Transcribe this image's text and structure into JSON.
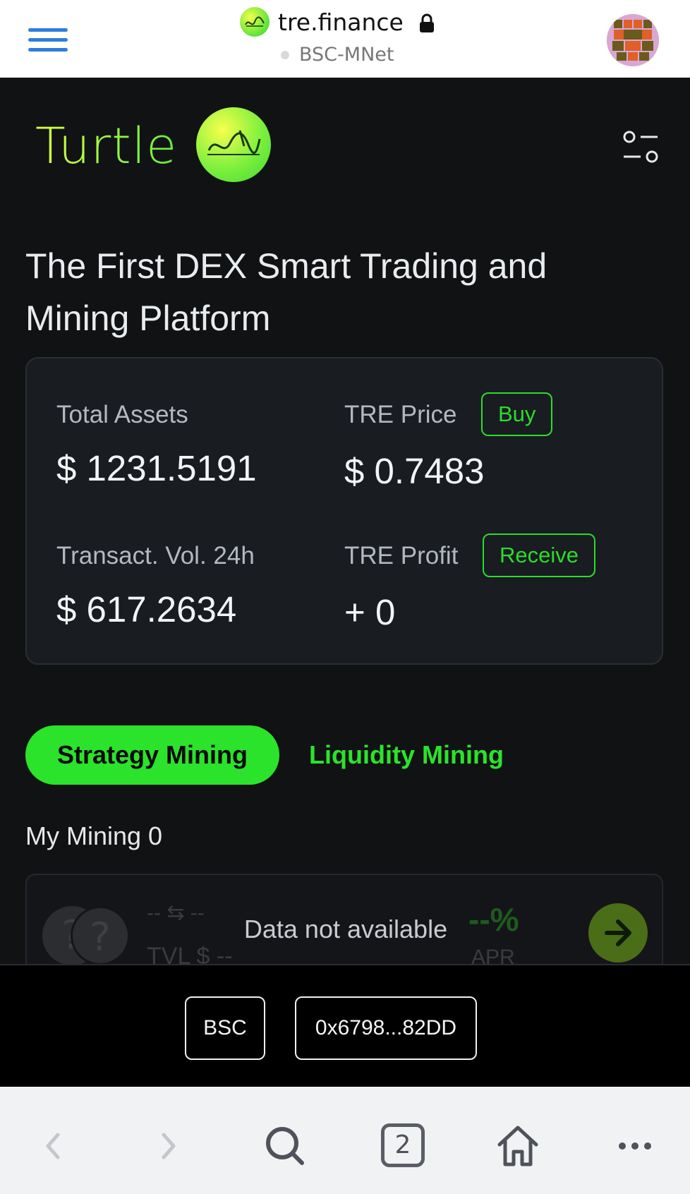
{
  "browser": {
    "domain": "tre.finance",
    "network": "BSC-MNet",
    "tab_count": "2",
    "icons": [
      "hamburger-menu-icon",
      "lock-icon",
      "back-icon",
      "forward-icon",
      "search-icon",
      "home-icon",
      "more-icon"
    ]
  },
  "header": {
    "logo_text": "Turtle"
  },
  "headline": "The First DEX Smart Trading and Mining Platform",
  "stats": {
    "total_assets_label": "Total Assets",
    "total_assets_value": "$ 1231.5191",
    "tre_price_label": "TRE Price",
    "tre_price_value": "$ 0.7483",
    "buy_label": "Buy",
    "volume_label": "Transact. Vol. 24h",
    "volume_value": "$ 617.2634",
    "tre_profit_label": "TRE Profit",
    "tre_profit_value": "+ 0",
    "receive_label": "Receive"
  },
  "tabs": {
    "active": "Strategy Mining",
    "inactive": "Liquidity Mining"
  },
  "my_mining": "My Mining 0",
  "mining_card": {
    "pair": "-- ⇆ --",
    "tvl": "TVL $ --",
    "apr_value": "--%",
    "apr_label": "APR",
    "coin_glyph": "?",
    "message": "Data not available"
  },
  "wallet": {
    "chain": "BSC",
    "address": "0x6798...82DD"
  },
  "colors": {
    "accent_green": "#2be32b",
    "background": "#111213",
    "card": "#191c21"
  }
}
